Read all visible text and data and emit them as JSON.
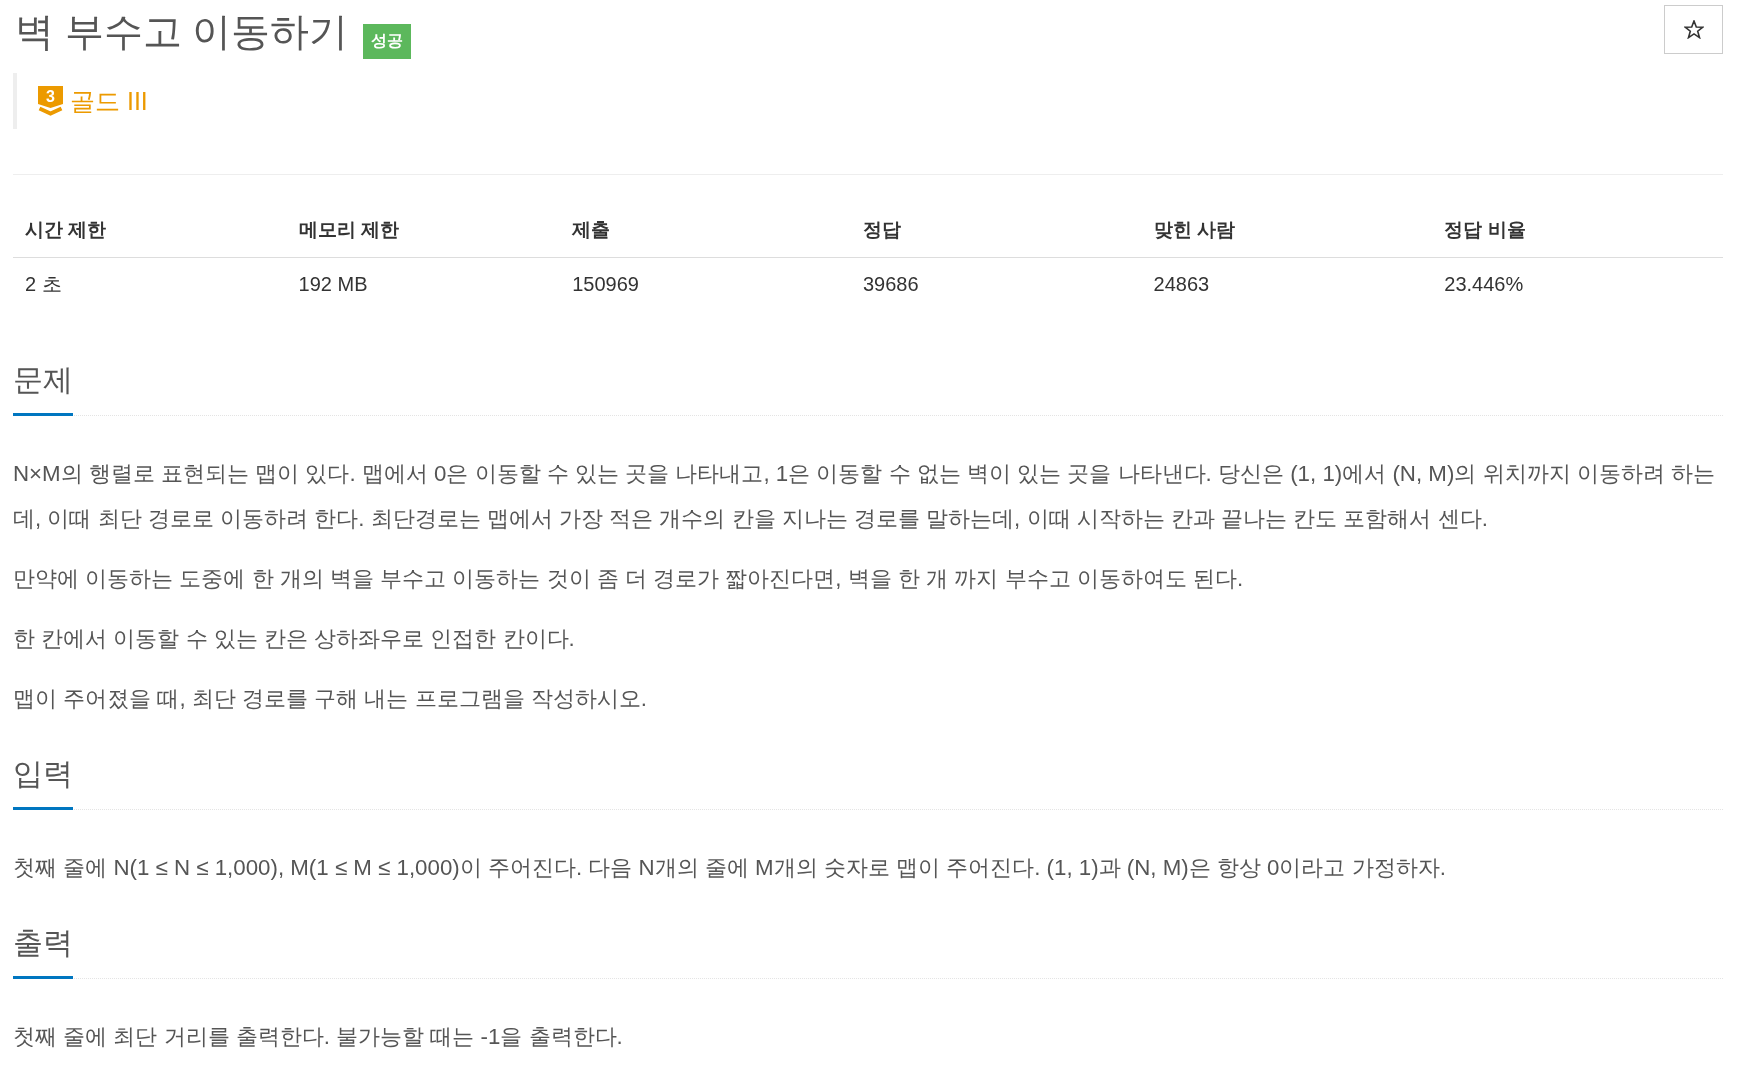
{
  "title": "벽 부수고 이동하기",
  "result_badge": {
    "label": "성공"
  },
  "star_button": {
    "starred": false
  },
  "tier": {
    "number": "3",
    "label": "골드 III"
  },
  "table": {
    "columns": [
      "시간 제한",
      "메모리 제한",
      "제출",
      "정답",
      "맞힌 사람",
      "정답 비율"
    ],
    "rows": [
      [
        "2 초",
        "192 MB",
        "150969",
        "39686",
        "24863",
        "23.446%"
      ]
    ]
  },
  "sections": [
    {
      "heading": "문제",
      "paragraphs": [
        "N×M의 행렬로 표현되는 맵이 있다. 맵에서 0은 이동할 수 있는 곳을 나타내고, 1은 이동할 수 없는 벽이 있는 곳을 나타낸다. 당신은 (1, 1)에서 (N, M)의 위치까지 이동하려 하는데, 이때 최단 경로로 이동하려 한다. 최단경로는 맵에서 가장 적은 개수의 칸을 지나는 경로를 말하는데, 이때 시작하는 칸과 끝나는 칸도 포함해서 센다.",
        "만약에 이동하는 도중에 한 개의 벽을 부수고 이동하는 것이 좀 더 경로가 짧아진다면, 벽을 한 개 까지 부수고 이동하여도 된다.",
        "한 칸에서 이동할 수 있는 칸은 상하좌우로 인접한 칸이다.",
        "맵이 주어졌을 때, 최단 경로를 구해 내는 프로그램을 작성하시오."
      ]
    },
    {
      "heading": "입력",
      "paragraphs": [
        "첫째 줄에 N(1 ≤ N ≤ 1,000), M(1 ≤ M ≤ 1,000)이 주어진다. 다음 N개의 줄에 M개의 숫자로 맵이 주어진다. (1, 1)과 (N, M)은 항상 0이라고 가정하자."
      ]
    },
    {
      "heading": "출력",
      "paragraphs": [
        "첫째 줄에 최단 거리를 출력한다. 불가능할 때는 -1을 출력한다."
      ]
    }
  ]
}
